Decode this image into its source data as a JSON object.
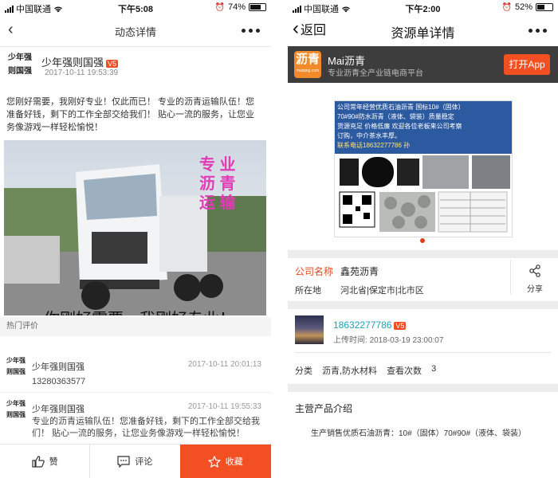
{
  "left": {
    "status": {
      "carrier": "中国联通",
      "time": "下午5:08",
      "battery": "74%",
      "battery_level": 0.74
    },
    "nav": {
      "back_icon": "chevron-left-icon",
      "title": "动态详情",
      "more_icon": "more-dots-icon"
    },
    "post": {
      "logo_line1": "少年强",
      "logo_line2": "则国强",
      "username": "少年强则国强",
      "badge": "V5",
      "time": "2017-10-11 19:53:39",
      "text": "您刚好需要，我刚好专业！仅此而已！ 专业的沥青运输队伍！您准备好钱，剩下的工作全部交给我们！ 贴心一流的服务，让您业务像游戏一样轻松愉悦！",
      "overlay_line1": "专  业",
      "overlay_line2": "沥  青",
      "overlay_line3": "运  输",
      "bottom_caption": "你刚好需要，我刚好专业！"
    },
    "comments_title": "热门评价",
    "comments": [
      {
        "name": "少年强则国强",
        "time": "2017-10-11 20:01:13",
        "text": "13280363577"
      },
      {
        "name": "少年强则国强",
        "time": "2017-10-11 19:55:33",
        "text": "专业的沥青运输队伍！您准备好钱，剩下的工作全部交给我们！ 贴心一流的服务，让您业务像游戏一样轻松愉悦！"
      }
    ],
    "bottom_bar": {
      "like": "赞",
      "comment": "评论",
      "collect": "收藏"
    }
  },
  "right": {
    "status": {
      "carrier": "中国联通",
      "time": "下午2:00",
      "battery": "52%",
      "battery_level": 0.52
    },
    "nav": {
      "back": "返回",
      "title": "资源单详情",
      "more_icon": "more-dots-icon"
    },
    "banner": {
      "logo": "沥青",
      "logo_domain": "maiqing.com",
      "title": "Mai沥青",
      "subtitle": "专业沥青全产业链电商平台",
      "open_button": "打开App"
    },
    "product_image": {
      "text_line1": "公司常年经营优质石油沥青   国标10#（固体）",
      "text_line2": "70#90#防水沥青（液体、袋装）质量稳定",
      "text_line3": "货源充足 价格低廉  欢迎各位老板来公司考察",
      "text_line4": "订购，中介茶水丰厚。",
      "text_line5": "联系电话18632277786 孙"
    },
    "company": {
      "label": "公司名称",
      "value": "鑫苑沥青"
    },
    "location": {
      "label": "所在地",
      "value": "河北省|保定市|北市区"
    },
    "share": {
      "label": "分享"
    },
    "seller": {
      "phone": "18632277786",
      "badge": "V5",
      "upload_label": "上传时间:",
      "upload_time": "2018-03-19 23:00:07"
    },
    "category": {
      "label": "分类",
      "value": "沥青,防水材料",
      "views_label": "查看次数",
      "views": "3"
    },
    "main_products": {
      "title": "主营产品介绍",
      "text": "生产销售优质石油沥青：10#（固体）70#90#（液体、袋装）"
    }
  }
}
